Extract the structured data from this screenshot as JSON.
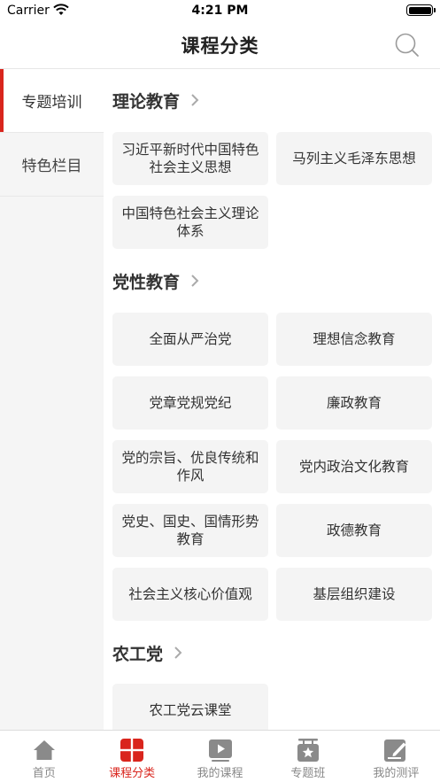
{
  "status_bar": {
    "carrier": "Carrier",
    "time": "4:21 PM"
  },
  "nav": {
    "title": "课程分类",
    "search_icon": "search-icon"
  },
  "sidebar": {
    "items": [
      {
        "label": "专题培训",
        "active": true
      },
      {
        "label": "特色栏目",
        "active": false
      }
    ]
  },
  "sections": [
    {
      "title": "理论教育",
      "tiles": [
        "习近平新时代中国特色社会主义思想",
        "马列主义毛泽东思想",
        "中国特色社会主义理论体系"
      ]
    },
    {
      "title": "党性教育",
      "tiles": [
        "全面从严治党",
        "理想信念教育",
        "党章党规党纪",
        "廉政教育",
        "党的宗旨、优良传统和作风",
        "党内政治文化教育",
        "党史、国史、国情形势教育",
        "政德教育",
        "社会主义核心价值观",
        "基层组织建设"
      ]
    },
    {
      "title": "农工党",
      "tiles": [
        "农工党云课堂"
      ]
    }
  ],
  "tab_bar": {
    "items": [
      {
        "label": "首页",
        "icon": "home-icon",
        "active": false
      },
      {
        "label": "课程分类",
        "icon": "category-grid-icon",
        "active": true
      },
      {
        "label": "我的课程",
        "icon": "play-icon",
        "active": false
      },
      {
        "label": "专题班",
        "icon": "star-board-icon",
        "active": false
      },
      {
        "label": "我的测评",
        "icon": "edit-icon",
        "active": false
      }
    ]
  },
  "colors": {
    "accent": "#d9251d",
    "tile_bg": "#f4f4f4",
    "sidebar_bg": "#f5f5f5",
    "inactive": "#888888"
  }
}
